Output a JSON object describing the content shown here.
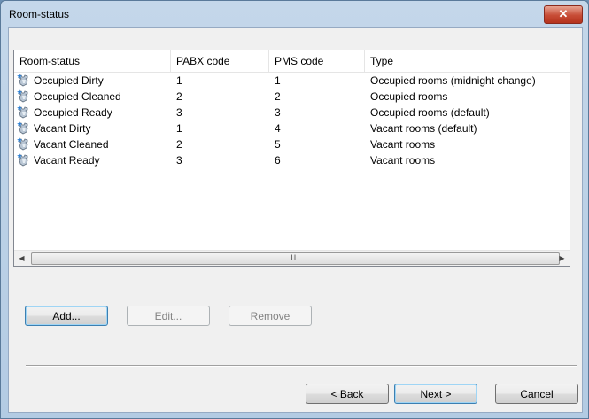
{
  "window": {
    "title": "Room-status",
    "close_glyph": "✕"
  },
  "list": {
    "columns": [
      "Room-status",
      "PABX code",
      "PMS code",
      "Type"
    ],
    "rows": [
      {
        "status": "Occupied Dirty",
        "pabx": "1",
        "pms": "1",
        "type": "Occupied rooms (midnight change)"
      },
      {
        "status": "Occupied Cleaned",
        "pabx": "2",
        "pms": "2",
        "type": "Occupied rooms"
      },
      {
        "status": "Occupied Ready",
        "pabx": "3",
        "pms": "3",
        "type": "Occupied rooms (default)"
      },
      {
        "status": "Vacant Dirty",
        "pabx": "1",
        "pms": "4",
        "type": "Vacant rooms (default)"
      },
      {
        "status": "Vacant Cleaned",
        "pabx": "2",
        "pms": "5",
        "type": "Vacant rooms"
      },
      {
        "status": "Vacant Ready",
        "pabx": "3",
        "pms": "6",
        "type": "Vacant rooms"
      }
    ],
    "row_icon": "room-status-icon",
    "scroll_thumb_grip": "III"
  },
  "buttons": {
    "add": "Add...",
    "edit": "Edit...",
    "remove": "Remove",
    "back": "< Back",
    "next": "Next >",
    "cancel": "Cancel"
  }
}
